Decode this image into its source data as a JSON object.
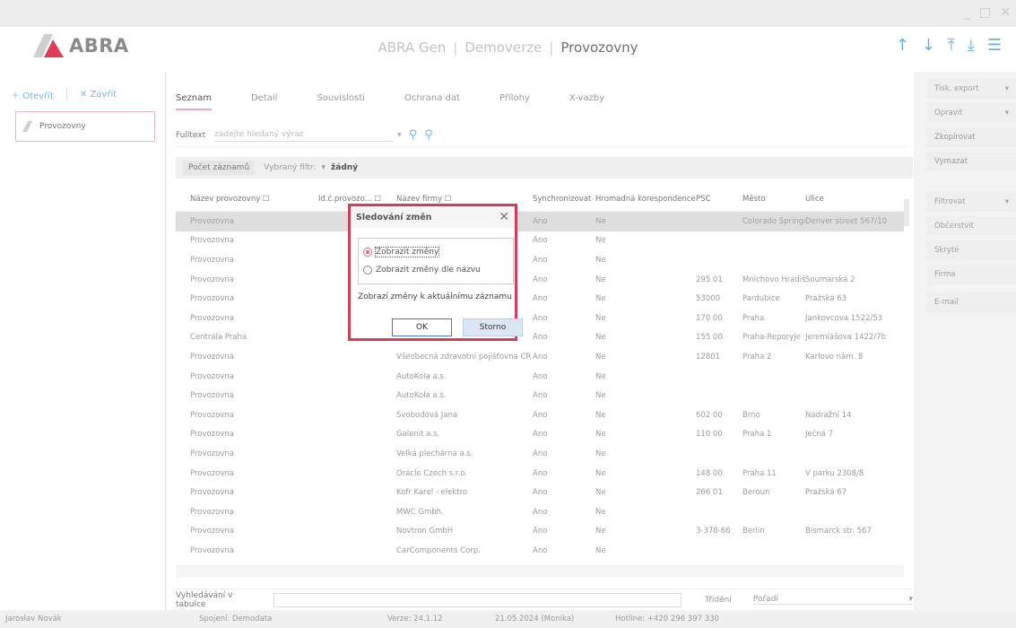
{
  "window": {
    "min": "_",
    "max": "□",
    "close": "✕"
  },
  "header": {
    "logo": "ABRA",
    "app": "ABRA Gen",
    "env": "Demoverze",
    "module": "Provozovny"
  },
  "left": {
    "open": "Otevřít",
    "close": "Zavřít",
    "item": "Provozovny"
  },
  "tabs": [
    "Seznam",
    "Detail",
    "Souvislosti",
    "Ochrana dat",
    "Přílohy",
    "X-vazby"
  ],
  "fulltext": {
    "label": "Fulltext",
    "placeholder": "zadejte hledaný výraz"
  },
  "filter": {
    "count": "Počet záznamů",
    "label": "Vybraný filtr:",
    "value": "žádný"
  },
  "table": {
    "headers": [
      "Název provozovny",
      "Id.č.provozo...",
      "Název firmy",
      "Synchronizovat",
      "Hromadná korespondence",
      "PSČ",
      "Město",
      "Ulice"
    ],
    "rows": [
      [
        "Provozovna",
        "",
        "",
        "Ano",
        "Ne",
        "",
        "Colorado Springs",
        "Denver street 567/10"
      ],
      [
        "Provozovna",
        "",
        "",
        "Ano",
        "Ne",
        "",
        "",
        ""
      ],
      [
        "Provozovna",
        "",
        "",
        "Ano",
        "Ne",
        "",
        "",
        ""
      ],
      [
        "Provozovna",
        "",
        "",
        "Ano",
        "Ne",
        "295 01",
        "Mnichovo Hradišti",
        "Soumarská 2"
      ],
      [
        "Provozovna",
        "",
        "",
        "Ano",
        "Ne",
        "53000",
        "Pardubice",
        "Pražská 63"
      ],
      [
        "Provozovna",
        "",
        "",
        "Ano",
        "Ne",
        "170 00",
        "Praha",
        "Jankovcova 1522/53"
      ],
      [
        "Centrála Praha",
        "",
        "",
        "Ano",
        "Ne",
        "155 00",
        "Praha-Řeporyje",
        "Jeremiášova 1422/7b"
      ],
      [
        "Provozovna",
        "",
        "Všeobecná zdravotní pojišťovna ČR",
        "Ano",
        "Ne",
        "12801",
        "Praha 2",
        "Karlovo nám. 8"
      ],
      [
        "Provozovna",
        "",
        "AutoKola a.s.",
        "Ano",
        "Ne",
        "",
        "",
        ""
      ],
      [
        "Provozovna",
        "",
        "AutoKola a.s.",
        "Ano",
        "Ne",
        "",
        "",
        ""
      ],
      [
        "Provozovna",
        "",
        "Svobodová Jana",
        "Ano",
        "Ne",
        "602 00",
        "Brno",
        "Nádražní 14"
      ],
      [
        "Provozovna",
        "",
        "Galenit a.s.",
        "Ano",
        "Ne",
        "110 00",
        "Praha 1",
        "Ječná 7"
      ],
      [
        "Provozovna",
        "",
        "Velká plechárna a.s.",
        "Ano",
        "Ne",
        "",
        "",
        ""
      ],
      [
        "Provozovna",
        "",
        "Oracle Czech s.r.o.",
        "Ano",
        "Ne",
        "148 00",
        "Praha 11",
        "V parku 2308/8"
      ],
      [
        "Provozovna",
        "",
        "Kofr Karel - elektro",
        "Ano",
        "Ne",
        "266 01",
        "Beroun",
        "Pražská 67"
      ],
      [
        "Provozovna",
        "",
        "MWC Gmbh.",
        "Ano",
        "Ne",
        "",
        "",
        ""
      ],
      [
        "Provozovna",
        "",
        "Novtron GmbH",
        "Ano",
        "Ne",
        "3-378-66",
        "Berlin",
        "Bismarck str. 567"
      ],
      [
        "Provozovna",
        "",
        "CarComponents Corp.",
        "Ano",
        "Ne",
        "",
        "",
        ""
      ]
    ]
  },
  "bottom": {
    "search_label": "Vyhledávání v tabulce",
    "sort_label": "Třídění",
    "sort_value": "Pořadí"
  },
  "right_buttons": [
    "Tisk, export",
    "Opravit",
    "Zkopírovat",
    "Vymazat",
    "Filtrovat",
    "Občerstvit",
    "Skryté",
    "Firma",
    "E-mail"
  ],
  "status": {
    "user": "Jaroslav Novák",
    "conn": "Spojení: Demodata",
    "version": "Verze: 24.1.12",
    "date": "21.05.2024 (Monika)",
    "hotline": "Hotline: +420 296 397 330"
  },
  "dialog": {
    "title": "Sledování změn",
    "opt1": "Zobrazit změny",
    "opt2": "Zobrazit změny dle názvu",
    "desc": "Zobrazí změny k aktuálnímu záznamu",
    "ok": "OK",
    "cancel": "Storno"
  },
  "colors": {
    "accent": "#6bb0e3",
    "dialog_border": "#d33d5a",
    "radio": "#e26a83"
  }
}
